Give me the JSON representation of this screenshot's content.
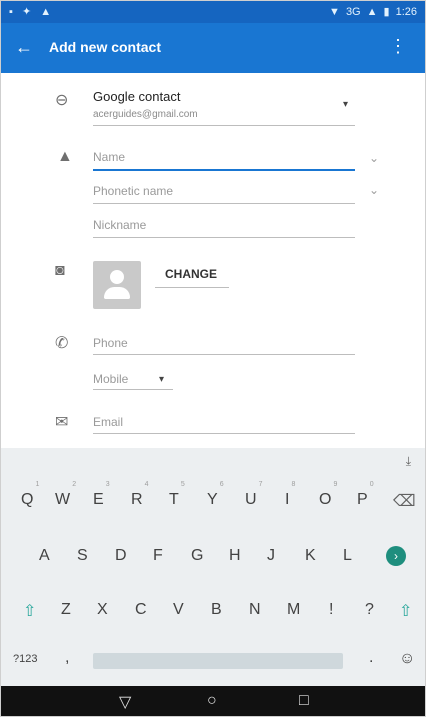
{
  "statusbar": {
    "left_icons": "▪ ✦ ▲",
    "network": "3G",
    "time": "1:26"
  },
  "appbar": {
    "title": "Add new contact",
    "back_icon": "←",
    "menu_icon": "⋮"
  },
  "form": {
    "account": {
      "label": "Google contact",
      "email": "acerguides@gmail.com"
    },
    "fields": {
      "name_placeholder": "Name",
      "phonetic_placeholder": "Phonetic name",
      "nickname_placeholder": "Nickname",
      "phone_placeholder": "Phone",
      "phone_type": "Mobile",
      "email_placeholder": "Email"
    },
    "photo": {
      "change_label": "CHANGE"
    }
  },
  "keyboard": {
    "row1": [
      {
        "key": "Q",
        "hint": "1"
      },
      {
        "key": "W",
        "hint": "2"
      },
      {
        "key": "E",
        "hint": "3"
      },
      {
        "key": "R",
        "hint": "4"
      },
      {
        "key": "T",
        "hint": "5"
      },
      {
        "key": "Y",
        "hint": "6"
      },
      {
        "key": "U",
        "hint": "7"
      },
      {
        "key": "I",
        "hint": "8"
      },
      {
        "key": "O",
        "hint": "9"
      },
      {
        "key": "P",
        "hint": "0"
      }
    ],
    "row2": [
      "A",
      "S",
      "D",
      "F",
      "G",
      "H",
      "J",
      "K",
      "L"
    ],
    "row3": [
      "Z",
      "X",
      "C",
      "V",
      "B",
      "N",
      "M",
      "!",
      "?"
    ],
    "symbols_label": "?123",
    "comma": ",",
    "period": ".",
    "enter_icon": "›"
  },
  "navbar": {
    "back": "▽",
    "home": "○",
    "recents": "□"
  }
}
